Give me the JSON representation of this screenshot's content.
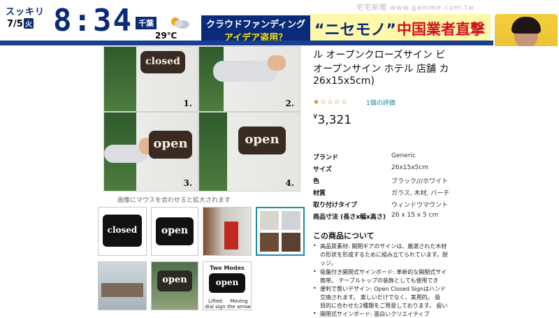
{
  "overlay": {
    "show_name": "スッキリ",
    "date": "7/5",
    "date_day": "火",
    "clock": "8:34",
    "weather": {
      "prefecture": "千葉",
      "temperature": "29℃",
      "icon": "sun-cloud-icon"
    },
    "headline_left": {
      "line1": "クラウドファンディング",
      "line2": "アイデア盗用？"
    },
    "headline_right": {
      "quote": "“ニセモノ”",
      "rest": "中国業者直撃"
    },
    "corner_logo": "宅宅新聞 www.gamme.com.tw",
    "colors": {
      "navy": "#0a2a7a",
      "accent_red": "#d10f1f",
      "accent_yellow": "#ffe600"
    }
  },
  "product": {
    "title_lines": [
      "ル オープンクローズサイン ビ",
      "オープンサイン ホテル 店舗 カ",
      "26x15x5cm)"
    ],
    "rating_stars": 1,
    "rating_max": 5,
    "review_link": "1個の評価",
    "price_symbol": "¥",
    "price": "3,321",
    "gallery": {
      "step_labels": [
        "1.",
        "2.",
        "3.",
        "4."
      ],
      "sign_text_closed": "closed",
      "sign_text_open": "open",
      "hover_caption": "画像にマウスを合わせると拡大されます"
    },
    "thumbnails": {
      "thumb1_text": "closed",
      "thumb2_text": "open",
      "thumb6_text": "open",
      "thumb7_header": "Two Modes",
      "thumb7_caption_left": "Lifted dial sign",
      "thumb7_caption_right": "Moving the arrow sign",
      "selected_index": 3
    },
    "specs": [
      {
        "label": "ブランド",
        "value": "Generic"
      },
      {
        "label": "サイズ",
        "value": "26x15x5cm"
      },
      {
        "label": "色",
        "value": "ブラック///ホワイト"
      },
      {
        "label": "材質",
        "value": "ガラス, 木材, バーチ"
      },
      {
        "label": "取り付けタイプ",
        "value": "ウィンドウマウント"
      },
      {
        "label": "商品寸法 (長さx幅x高さ)",
        "value": "26 x 15 x 5 cm"
      }
    ],
    "about_title": "この商品について",
    "bullets": [
      "高品質素材: 開閉ギアのサインは、厳選された木材",
      "の形状を形成するために組み立てられています。耐",
      "ッジ。",
      "吸盤付き開閉式サインボード: 革新的な開閉式サイ",
      "簡単。 テーブルトップの装飾としても使用でき",
      "便利で賢いデザイン: Open Closed Signはハンド",
      "交換されます。 楽しいだけでなく、実用的。 扱",
      "目的に合わせた2種類をご用意しております。 扱い",
      "開閉式サインボード: 面白いクリエイティブ"
    ]
  }
}
